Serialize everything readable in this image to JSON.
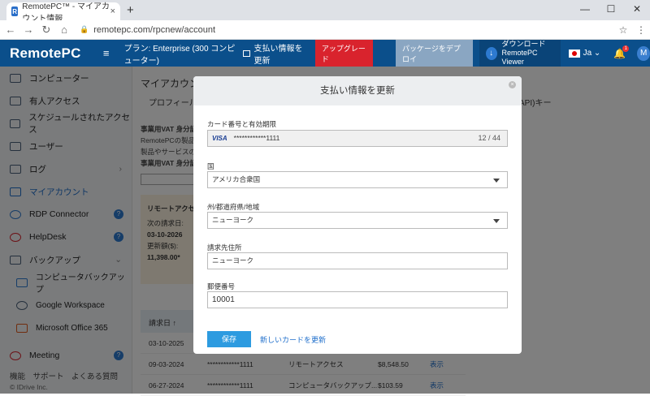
{
  "browser": {
    "tab_title": "RemotePC™ - マイアカウント情報",
    "tab_close": "×",
    "new_tab": "+",
    "url": "remotepc.com/rpcnew/account",
    "window_controls": [
      "—",
      "☐",
      "✕"
    ]
  },
  "header": {
    "logo": "RemotePC",
    "plan": "プラン: Enterprise (300 コンピューター)",
    "update_payment": "支払い情報を更新",
    "upgrade": "アップグレード",
    "deploy_package": "パッケージをデプロイ",
    "download_line1": "ダウンロード",
    "download_line2": "RemotePC Viewer",
    "language": "Ja",
    "avatar_letter": "M",
    "bell_badge": "1"
  },
  "sidebar": {
    "items": [
      {
        "label": "コンピューター"
      },
      {
        "label": "有人アクセス"
      },
      {
        "label": "スケジュールされたアクセス"
      },
      {
        "label": "ユーザー"
      },
      {
        "label": "ログ"
      },
      {
        "label": "マイアカウント"
      },
      {
        "label": "RDP Connector"
      },
      {
        "label": "HelpDesk"
      },
      {
        "label": "バックアップ"
      },
      {
        "label": "コンピュータバックアップ"
      },
      {
        "label": "Google Workspace"
      },
      {
        "label": "Microsoft Office 365"
      },
      {
        "label": "Meeting"
      }
    ],
    "footer": "機能　サポート　よくある質問",
    "copyright": "© IDrive Inc."
  },
  "main": {
    "title": "マイアカウント",
    "tab_profile": "プロフィール",
    "tab_api": "API)キー",
    "vat_title": "事業用VAT 身分証明",
    "vat_text1": "RemotePCの製品とサ",
    "vat_text2": "製品やサービスの利",
    "vat_label": "事業用VAT 身分証明書",
    "card_title": "リモートアクセ",
    "next_bill_label": "次の請求日:",
    "next_bill_date": "03-10-2026",
    "renew_label": "更新額($):",
    "renew_amount": "11,398.00*",
    "table_header": "請求日",
    "rows": [
      {
        "date": "03-10-2025",
        "card": "",
        "product": "",
        "amount": "",
        "action": ""
      },
      {
        "date": "09-03-2024",
        "card": "************1111",
        "product": "リモートアクセス",
        "amount": "$8,548.50",
        "action": "表示"
      },
      {
        "date": "06-27-2024",
        "card": "************1111",
        "product": "コンピュータバックアップ...",
        "amount": "$103.59",
        "action": "表示"
      }
    ]
  },
  "modal": {
    "title": "支払い情報を更新",
    "close": "×",
    "card_label": "カード番号と有効期限",
    "card_brand": "VISA",
    "card_number": "************1111",
    "card_expiry": "12 / 44",
    "country_label": "国",
    "country_value": "アメリカ合衆国",
    "state_label": "州/都道府県/地域",
    "state_value": "ニューヨーク",
    "billing_label": "請求先住所",
    "billing_value": "ニューヨーク",
    "zip_label": "郵便番号",
    "zip_value": "10001",
    "save": "保存",
    "new_card": "新しいカードを更新"
  }
}
